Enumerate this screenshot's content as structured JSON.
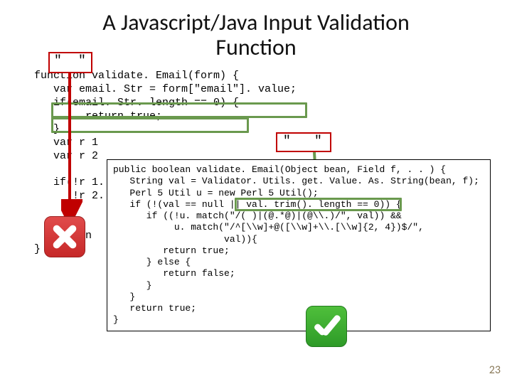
{
  "title_line1": "A Javascript/Java Input Validation",
  "title_line2": "Function",
  "quotes": {
    "q1": "\"",
    "q2": "\""
  },
  "js_code": "function validate. Email(form) {\n   var email. Str = form[\"email\"]. value;\n   if(email. Str. length == 0) {\n        return true;\n   }\n   var r 1\n   var r 2\n\n   if(!r 1.\n      !r 2.\n\n   }\n   return\n}",
  "java_code": "public boolean validate. Email(Object bean, Field f, . . ) {\n   String val = Validator. Utils. get. Value. As. String(bean, f);\n   Perl 5 Util u = new Perl 5 Util();\n   if (!(val == null || val. trim(). length == 0)) {\n      if ((!u. match(\"/( )|(@.*@)|(@\\\\.)/\", val)) &&\n           u. match(\"/^[\\\\w]+@([\\\\w]+\\\\.[\\\\w]{2, 4})$/\",\n                    val)){\n         return true;\n      } else {\n         return false;\n      }\n   }\n   return true;\n}",
  "page_number": "23"
}
